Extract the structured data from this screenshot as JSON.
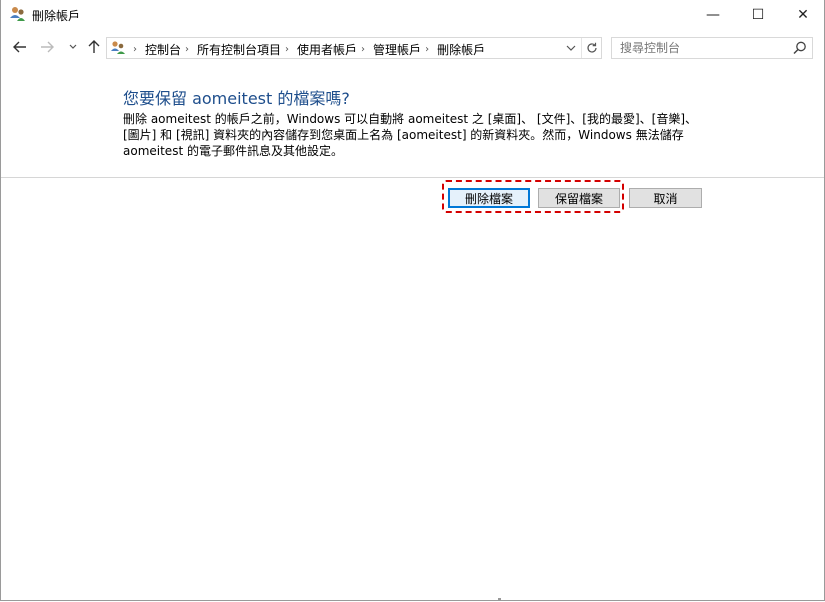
{
  "window": {
    "title": "刪除帳戶",
    "controls": {
      "minimize": "—",
      "maximize": "☐",
      "close": "✕"
    }
  },
  "navigation": {
    "back_icon": "arrow-left-icon",
    "forward_icon": "arrow-right-icon",
    "recent_icon": "chevron-down-icon",
    "up_icon": "arrow-up-icon",
    "breadcrumbs": [
      "控制台",
      "所有控制台項目",
      "使用者帳戶",
      "管理帳戶",
      "刪除帳戶"
    ],
    "refresh_icon": "refresh-icon"
  },
  "search": {
    "placeholder": "搜尋控制台",
    "value": ""
  },
  "content": {
    "heading": "您要保留 aomeitest 的檔案嗎?",
    "description": "刪除 aomeitest 的帳戶之前，Windows 可以自動將 aomeitest 之 [桌面]、 [文件]、[我的最愛]、[音樂]、[圖片] 和 [視訊] 資料夾的內容儲存到您桌面上名為 [aomeitest] 的新資料夾。然而，Windows 無法儲存 aomeitest 的電子郵件訊息及其他設定。"
  },
  "buttons": {
    "delete_files": "刪除檔案",
    "keep_files": "保留檔案",
    "cancel": "取消"
  },
  "colors": {
    "heading": "#1e4e8c",
    "highlight": "#d40000",
    "focus": "#0078d7"
  }
}
